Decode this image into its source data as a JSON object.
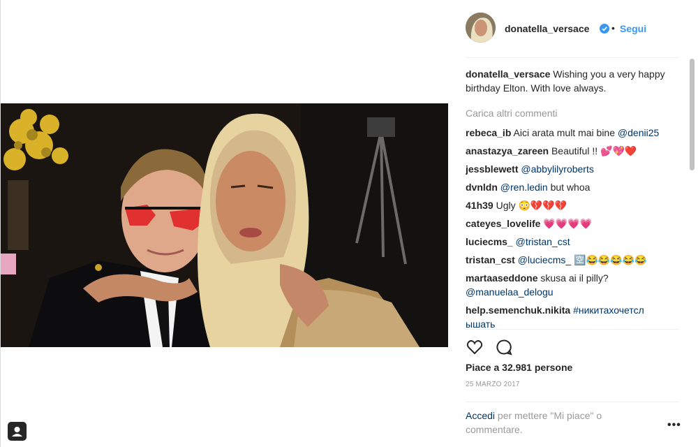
{
  "post": {
    "username": "donatella_versace",
    "follow_label": "Segui",
    "dot": "•",
    "caption_username": "donatella_versace",
    "caption_text": "Wishing you a very happy birthday Elton. With love always.",
    "load_more": "Carica altri commenti",
    "comments": [
      {
        "user": "rebeca_ib",
        "text": "Aici arata mult mai bine ",
        "mention": "@denii25"
      },
      {
        "user": "anastazya_zareen",
        "text": "Beautiful !! 💕💖❤️",
        "mention": ""
      },
      {
        "user": "jessblewett",
        "text": "",
        "mention": "@abbylilyroberts"
      },
      {
        "user": "dvnldn",
        "text": " but whoa",
        "mention": "@ren.ledin",
        "mention_first": true
      },
      {
        "user": "41h39",
        "text": "Ugly 😳💔💔💔",
        "mention": ""
      },
      {
        "user": "cateyes_lovelife",
        "text": "💗💗💗💗",
        "mention": ""
      },
      {
        "user": "luciecms_",
        "text": "",
        "mention": "@tristan_cst"
      },
      {
        "user": "tristan_cst",
        "text": " 🈳😂😂😂😂😂",
        "mention": "@luciecms_",
        "mention_first": true
      },
      {
        "user": "martaaseddone",
        "text": "skusa ai il pilly? ",
        "mention": "@manuelaa_delogu"
      },
      {
        "user": "help.semenchuk.nikita",
        "text": "",
        "mention": "#никитахочетсл ышать"
      }
    ],
    "likes": "Piace a 32.981 persone",
    "date": "25 MARZO 2017",
    "login_link": "Accedi",
    "login_text": " per mettere \"Mi piace\" o commentare.",
    "more_label": "•••"
  },
  "icons": {
    "heart": "heart-icon",
    "comment": "comment-icon",
    "verified": "verified-badge-icon",
    "user_tag": "user-tag-icon"
  },
  "colors": {
    "link_blue": "#3897f0",
    "mention_blue": "#003569",
    "muted": "#999999",
    "text": "#262626"
  }
}
